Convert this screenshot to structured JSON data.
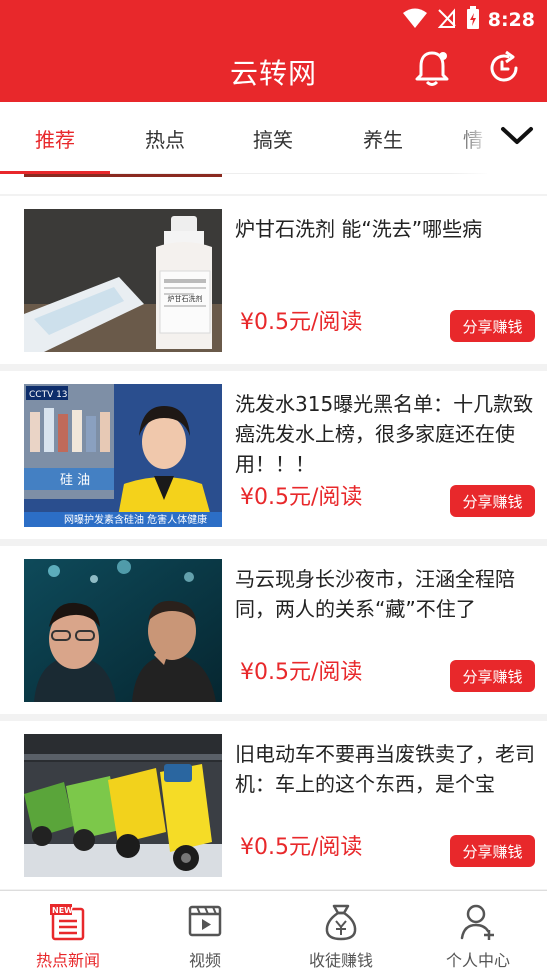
{
  "status_bar": {
    "time": "8:28"
  },
  "app": {
    "title": "云转网"
  },
  "tabs": [
    {
      "label": "推荐",
      "active": true
    },
    {
      "label": "热点",
      "active": false
    },
    {
      "label": "搞笑",
      "active": false
    },
    {
      "label": "养生",
      "active": false
    },
    {
      "label": "情",
      "active": false
    }
  ],
  "articles": [
    {
      "title": "炉甘石洗剂 能“洗去”哪些病",
      "price": "¥0.5元/阅读",
      "share_label": "分享赚钱",
      "thumb": "medicine-bottle"
    },
    {
      "title": "洗发水315曝光黑名单：十几款致癌洗发水上榜，很多家庭还在使用！！！",
      "price": "¥0.5元/阅读",
      "share_label": "分享赚钱",
      "thumb": "news-anchor"
    },
    {
      "title": "马云现身长沙夜市，汪涵全程陪同，两人的关系“藏”不住了",
      "price": "¥0.5元/阅读",
      "share_label": "分享赚钱",
      "thumb": "two-men"
    },
    {
      "title": "旧电动车不要再当废铁卖了，老司机：车上的这个东西，是个宝",
      "price": "¥0.5元/阅读",
      "share_label": "分享赚钱",
      "thumb": "e-scooters"
    }
  ],
  "thumb_text": {
    "bottle_label": "炉甘石洗剂",
    "cctv_logo": "CCTV 13",
    "caption": "硅 油",
    "ticker": "网曝护发素含硅油 危害人体健康"
  },
  "bottom_nav": [
    {
      "label": "热点新闻",
      "icon": "news-icon",
      "active": true
    },
    {
      "label": "视频",
      "icon": "video-icon",
      "active": false
    },
    {
      "label": "收徒赚钱",
      "icon": "money-bag-icon",
      "active": false
    },
    {
      "label": "个人中心",
      "icon": "person-icon",
      "active": false
    }
  ],
  "colors": {
    "brand": "#e8282b",
    "nav_inactive": "#555555"
  }
}
